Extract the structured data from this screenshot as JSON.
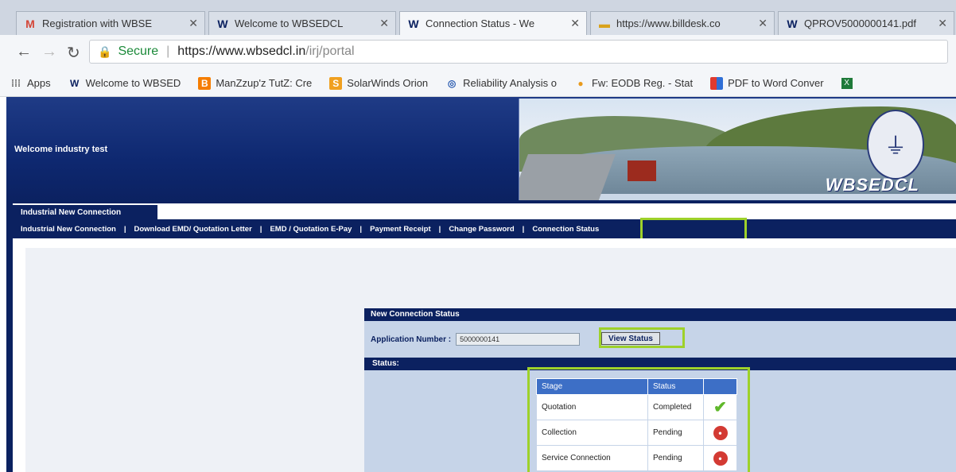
{
  "browser": {
    "tabs": [
      {
        "icon": "gmail-icon",
        "title": "Registration with WBSE"
      },
      {
        "icon": "wbsedcl-icon",
        "title": "Welcome to WBSEDCL"
      },
      {
        "icon": "wbsedcl-icon",
        "title": "Connection Status - We"
      },
      {
        "icon": "billdesk-icon",
        "title": "https://www.billdesk.co"
      },
      {
        "icon": "wbsedcl-icon",
        "title": "QPROV5000000141.pdf"
      }
    ],
    "secure_label": "Secure",
    "url_host": "https://www.wbsedcl.in",
    "url_path": "/irj/portal",
    "bookmarks": [
      {
        "icon": "apps-icon",
        "label": "Apps"
      },
      {
        "icon": "wbsedcl-icon",
        "label": "Welcome to WBSED"
      },
      {
        "icon": "blogger-icon",
        "label": "ManZzup'z TutZ: Cre"
      },
      {
        "icon": "solarwinds-icon",
        "label": "SolarWinds Orion"
      },
      {
        "icon": "reliability-icon",
        "label": "Reliability Analysis o"
      },
      {
        "icon": "mail-icon",
        "label": "Fw: EODB Reg. - Stat"
      },
      {
        "icon": "pdf-icon",
        "label": "PDF to Word Conver"
      }
    ]
  },
  "page": {
    "welcome_text": "Welcome industry test",
    "logo_text": "WBSEDCL",
    "section_tab": "Industrial New Connection",
    "menu": [
      "Industrial New Connection",
      "Download EMD/ Quotation Letter",
      "EMD / Quotation E-Pay",
      "Payment Receipt",
      "Change Password",
      "Connection Status"
    ],
    "status_panel": {
      "title": "New Connection Status",
      "app_label": "Application Number :",
      "app_value": "5000000141",
      "view_button": "View Status",
      "status_title": "Status:",
      "table": {
        "headers": [
          "Stage",
          "Status",
          ""
        ],
        "rows": [
          {
            "stage": "Quotation",
            "status": "Completed",
            "icon": "check-icon"
          },
          {
            "stage": "Collection",
            "status": "Pending",
            "icon": "pending-icon"
          },
          {
            "stage": "Service Connection",
            "status": "Pending",
            "icon": "pending-icon"
          }
        ]
      }
    }
  },
  "colors": {
    "navy": "#0b2160",
    "highlight": "#9ed12a",
    "table_header": "#3d6fc6",
    "panel_bg": "#c6d4e8"
  }
}
